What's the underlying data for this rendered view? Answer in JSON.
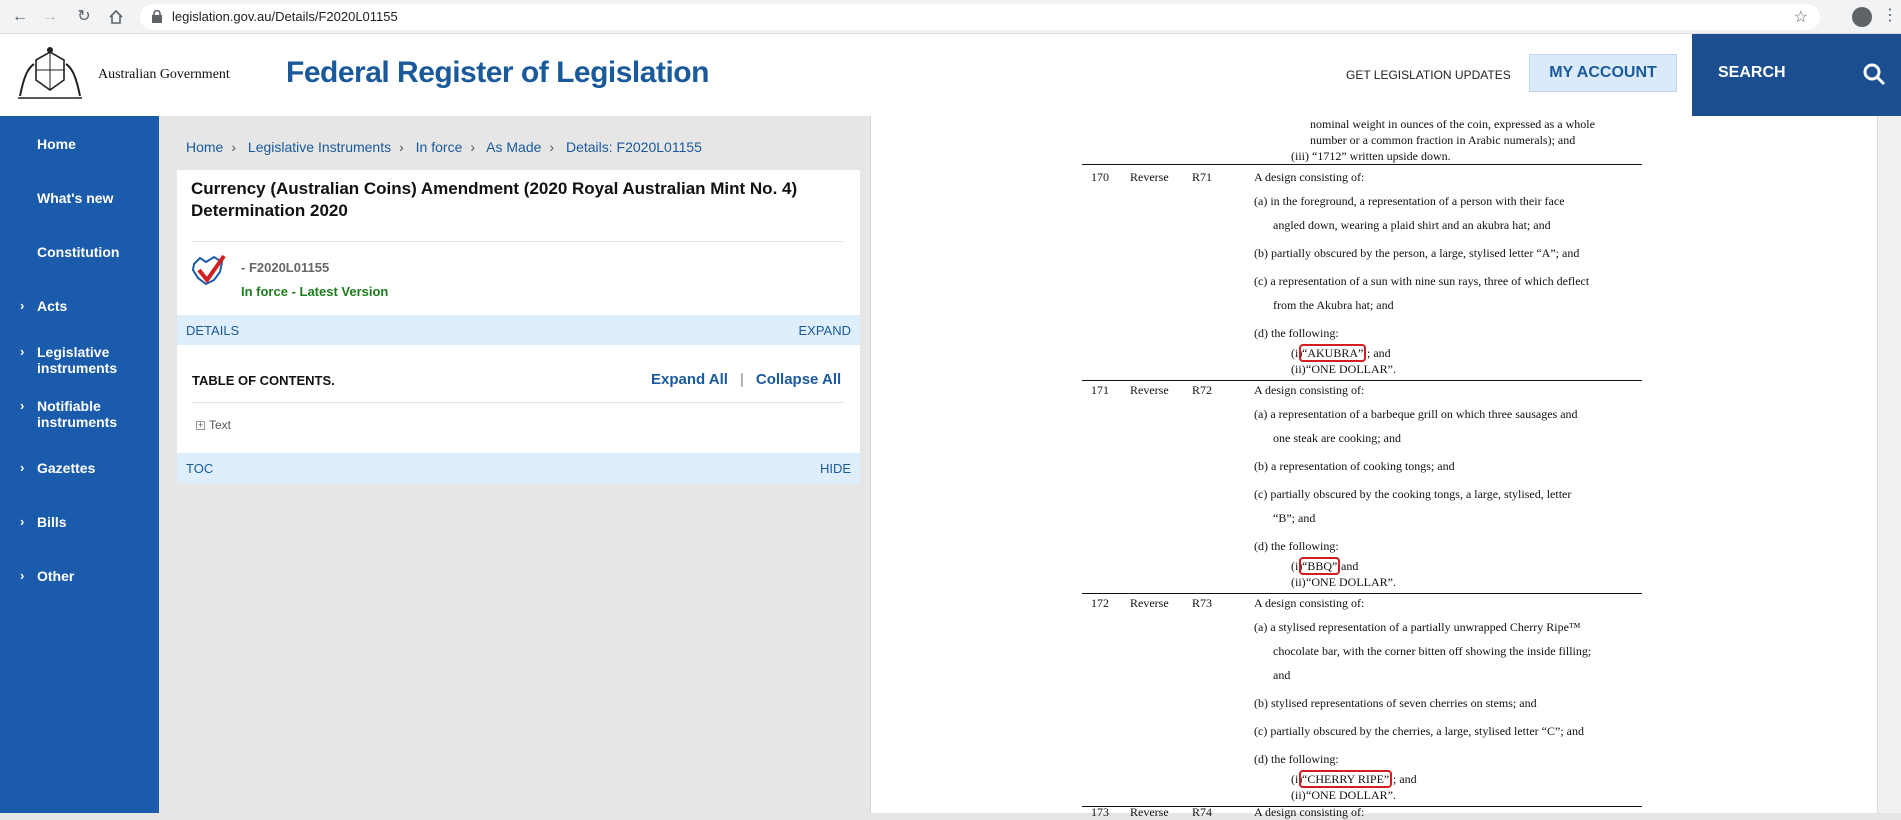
{
  "browser": {
    "url": "legislation.gov.au/Details/F2020L01155"
  },
  "header": {
    "gov_name": "Australian Government",
    "site_title": "Federal Register of Legislation",
    "updates_link": "GET LEGISLATION UPDATES",
    "my_account": "MY ACCOUNT",
    "search": "SEARCH"
  },
  "sidebar": {
    "items": [
      {
        "label": "Home",
        "chevron": ""
      },
      {
        "label": "What's new",
        "chevron": ""
      },
      {
        "label": "Constitution",
        "chevron": ""
      },
      {
        "label": "Acts",
        "chevron": "›"
      },
      {
        "label": "Legislative instruments",
        "chevron": "›"
      },
      {
        "label": "Notifiable instruments",
        "chevron": "›"
      },
      {
        "label": "Gazettes",
        "chevron": "›"
      },
      {
        "label": "Bills",
        "chevron": "›"
      },
      {
        "label": "Other",
        "chevron": "›"
      }
    ]
  },
  "breadcrumb": [
    "Home",
    "Legislative Instruments",
    "In force",
    "As Made",
    "Details: F2020L01155"
  ],
  "document": {
    "title": "Currency (Australian Coins) Amendment (2020 Royal Australian Mint No. 4) Determination 2020",
    "id": "- F2020L01155",
    "status": "In force - Latest Version",
    "details_label": "DETAILS",
    "expand_label": "EXPAND"
  },
  "toc": {
    "title": "TABLE OF CONTENTS.",
    "expand_all": "Expand All",
    "separator": "|",
    "collapse_all": "Collapse All",
    "item": "Text",
    "toc_label": "TOC",
    "hide_label": "HIDE"
  },
  "legislation": {
    "top_lines": [
      "nominal weight in ounces of the coin, expressed as a whole",
      "number or a common fraction in Arabic numerals); and",
      "(iii) “1712” written upside down."
    ],
    "rows": [
      {
        "num": "170",
        "side": "Reverse",
        "code": "R71",
        "intro": "A design consisting of:",
        "paras": [
          [
            "(a) in the foreground, a representation of a person with their face",
            "angled down, wearing a plaid shirt and an akubra hat; and"
          ],
          [
            "(b) partially obscured by the person, a large, stylised letter “A”; and"
          ],
          [
            "(c) a representation of a sun with nine sun rays, three of which deflect",
            "from the Akubra hat; and"
          ],
          [
            "(d) the following:"
          ]
        ],
        "sub": [
          {
            "pre": "(i) ",
            "text": "“AKUBRA”",
            "post": "; and"
          },
          {
            "pre": "(ii) ",
            "text": "“ONE DOLLAR”.",
            "post": ""
          }
        ]
      },
      {
        "num": "171",
        "side": "Reverse",
        "code": "R72",
        "intro": "A design consisting of:",
        "paras": [
          [
            "(a) a representation of a barbeque grill on which three sausages and",
            "one steak are cooking; and"
          ],
          [
            "(b) a representation of cooking tongs; and"
          ],
          [
            "(c) partially obscured by the cooking tongs, a large, stylised, letter",
            "“B”; and"
          ],
          [
            "(d) the following:"
          ]
        ],
        "sub": [
          {
            "pre": "(i) ",
            "text": "“BBQ”",
            "post": " and"
          },
          {
            "pre": "(ii) ",
            "text": "“ONE DOLLAR”.",
            "post": ""
          }
        ]
      },
      {
        "num": "172",
        "side": "Reverse",
        "code": "R73",
        "intro": "A design consisting of:",
        "paras": [
          [
            "(a) a stylised representation of a partially unwrapped Cherry Ripe™",
            "chocolate bar, with the corner bitten off showing the inside filling;",
            "and"
          ],
          [
            "(b) stylised representations of seven cherries on stems; and"
          ],
          [
            "(c) partially obscured by the cherries, a large, stylised letter “C”; and"
          ],
          [
            "(d) the following:"
          ]
        ],
        "sub": [
          {
            "pre": "(i) ",
            "text": "“CHERRY RIPE”",
            "post": "; and"
          },
          {
            "pre": "(ii) ",
            "text": "“ONE DOLLAR”.",
            "post": ""
          }
        ]
      }
    ],
    "next_row": {
      "num": "173",
      "side": "Reverse",
      "code": "R74",
      "intro": "A design consisting of:"
    }
  }
}
